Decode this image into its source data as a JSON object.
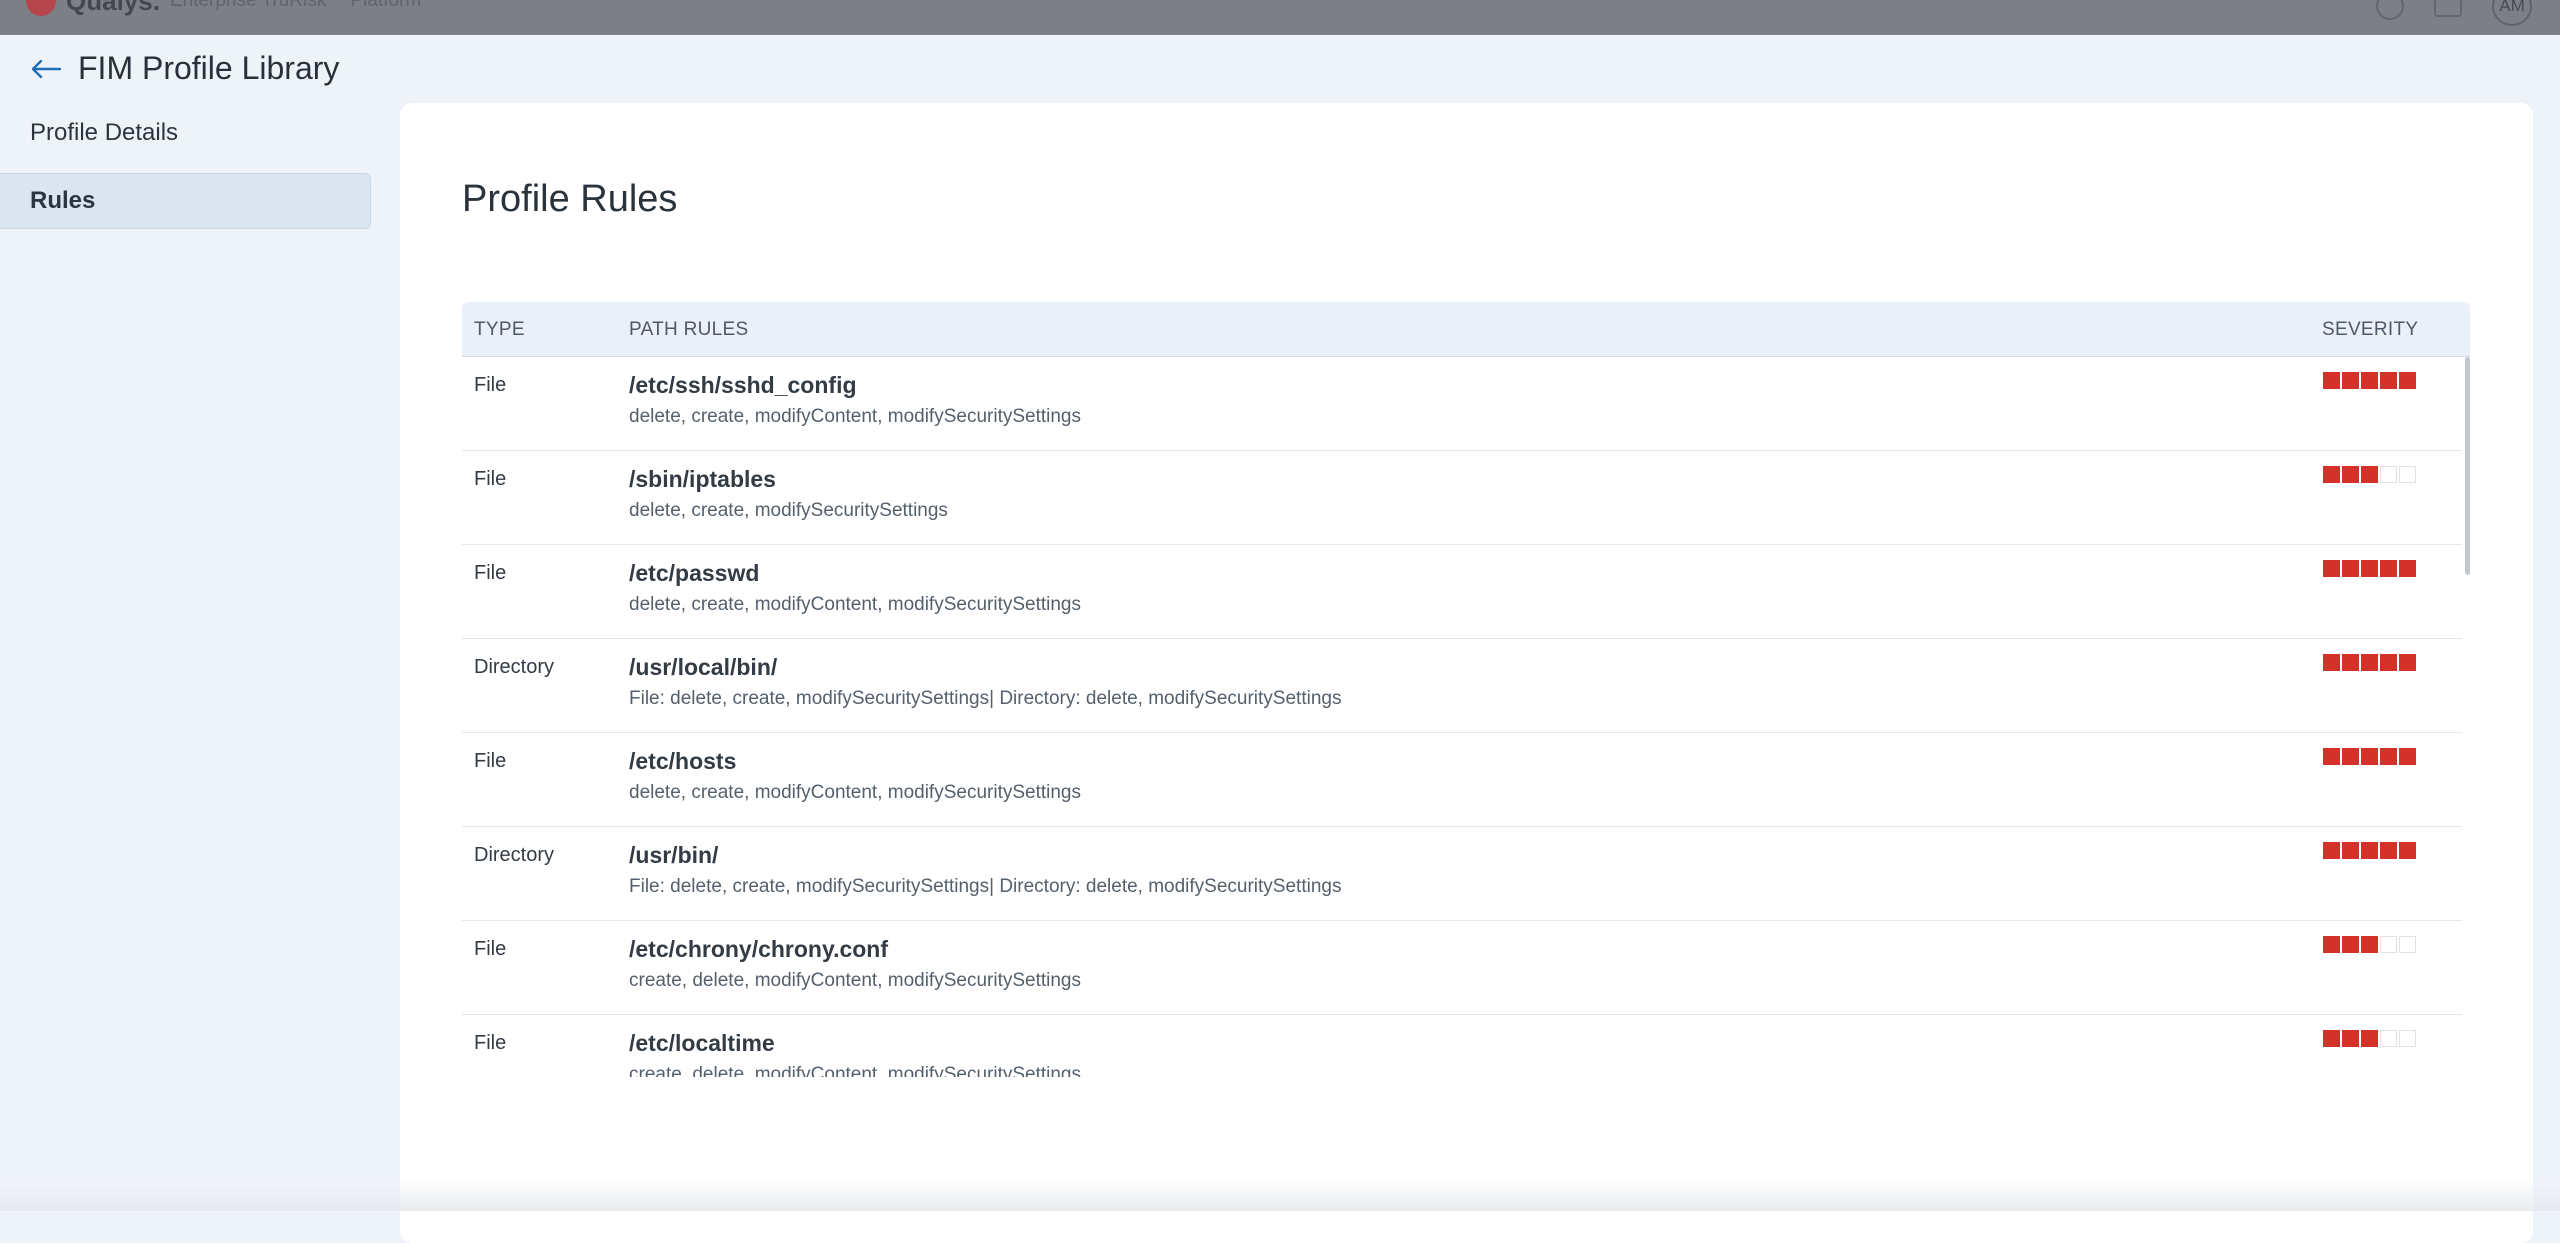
{
  "topbar": {
    "brand_name": "Qualys.",
    "brand_sub": "Enterprise TruRisk™ Platform",
    "avatar_initials": "AM"
  },
  "header": {
    "title": "FIM Profile Library"
  },
  "sidebar": {
    "items": [
      {
        "label": "Profile Details",
        "active": false
      },
      {
        "label": "Rules",
        "active": true
      }
    ]
  },
  "main": {
    "title": "Profile Rules",
    "columns": {
      "type": "TYPE",
      "path": "PATH RULES",
      "severity": "SEVERITY"
    },
    "rows": [
      {
        "type": "File",
        "path": "/etc/ssh/sshd_config",
        "ops": "delete, create, modifyContent, modifySecuritySettings",
        "severity": 5
      },
      {
        "type": "File",
        "path": "/sbin/iptables",
        "ops": "delete, create, modifySecuritySettings",
        "severity": 3
      },
      {
        "type": "File",
        "path": "/etc/passwd",
        "ops": "delete, create, modifyContent, modifySecuritySettings",
        "severity": 5
      },
      {
        "type": "Directory",
        "path": "/usr/local/bin/",
        "ops": "File: delete, create, modifySecuritySettings| Directory: delete, modifySecuritySettings",
        "severity": 5
      },
      {
        "type": "File",
        "path": "/etc/hosts",
        "ops": "delete, create, modifyContent, modifySecuritySettings",
        "severity": 5
      },
      {
        "type": "Directory",
        "path": "/usr/bin/",
        "ops": "File: delete, create, modifySecuritySettings| Directory: delete, modifySecuritySettings",
        "severity": 5
      },
      {
        "type": "File",
        "path": "/etc/chrony/chrony.conf",
        "ops": "create, delete, modifyContent, modifySecuritySettings",
        "severity": 3
      },
      {
        "type": "File",
        "path": "/etc/localtime",
        "ops": "create, delete, modifyContent, modifySecuritySettings",
        "severity": 3
      }
    ],
    "severity_max": 5
  },
  "colors": {
    "severity_on": "#d5312b",
    "accent": "#1f6fb5"
  },
  "icons": [
    "back-arrow-icon",
    "help-icon",
    "mail-icon",
    "brand-logo-icon"
  ]
}
